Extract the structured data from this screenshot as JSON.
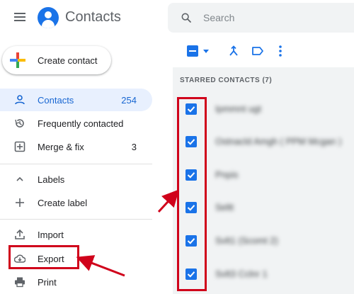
{
  "header": {
    "app_title": "Contacts",
    "search_placeholder": "Search"
  },
  "sidebar": {
    "create_label": "Create contact",
    "items": [
      {
        "label": "Contacts",
        "count": "254",
        "icon": "person-icon",
        "active": true
      },
      {
        "label": "Frequently contacted",
        "count": "",
        "icon": "history-icon"
      },
      {
        "label": "Merge & fix",
        "count": "3",
        "icon": "merge-icon"
      }
    ],
    "labels_header": "Labels",
    "create_label_item": "Create label",
    "import_label": "Import",
    "export_label": "Export",
    "print_label": "Print"
  },
  "toolbar": {
    "icons": [
      "select-all-checkbox",
      "select-dropdown-icon",
      "merge-icon",
      "label-icon",
      "more-vert-icon"
    ]
  },
  "list": {
    "section_title": "STARRED CONTACTS (7)",
    "rows": [
      {
        "name": "Ipmmnt ugt",
        "checked": true
      },
      {
        "name": "Ostnacld Amgh ( PPM Mcgan )",
        "checked": true
      },
      {
        "name": "Pnpis",
        "checked": true
      },
      {
        "name": "Seltt",
        "checked": true
      },
      {
        "name": "Svlt1 (Scomt 2)",
        "checked": true
      },
      {
        "name": "Svlt3 Cclnr 1",
        "checked": true
      }
    ]
  },
  "colors": {
    "accent": "#1a73e8",
    "active_bg": "#e8f0fe",
    "highlight_red": "#d0021b"
  }
}
